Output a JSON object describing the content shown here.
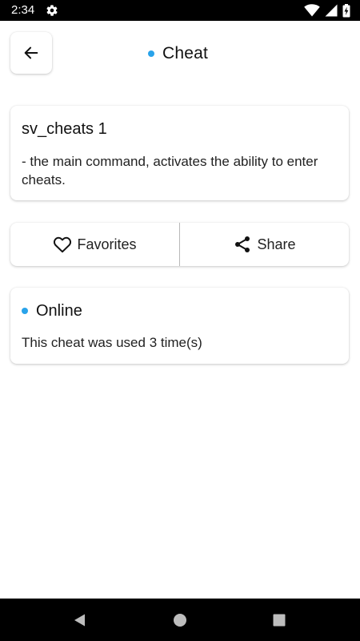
{
  "status_bar": {
    "time": "2:34",
    "icons": [
      "gear-icon",
      "wifi-icon",
      "cell-signal-icon",
      "battery-charging-icon"
    ]
  },
  "header": {
    "back_icon": "arrow-left-icon",
    "title": "Cheat",
    "accent_color": "#29a3ea"
  },
  "cheat": {
    "command": "sv_cheats 1",
    "description": "- the main command, activates the ability to enter cheats."
  },
  "actions": {
    "favorites_label": "Favorites",
    "favorites_icon": "heart-outline-icon",
    "share_label": "Share",
    "share_icon": "share-icon"
  },
  "online": {
    "label": "Online",
    "usage_text": "This cheat was used 3 time(s)"
  },
  "nav_bar": {
    "buttons": [
      "back-triangle-icon",
      "home-circle-icon",
      "recents-square-icon"
    ]
  }
}
